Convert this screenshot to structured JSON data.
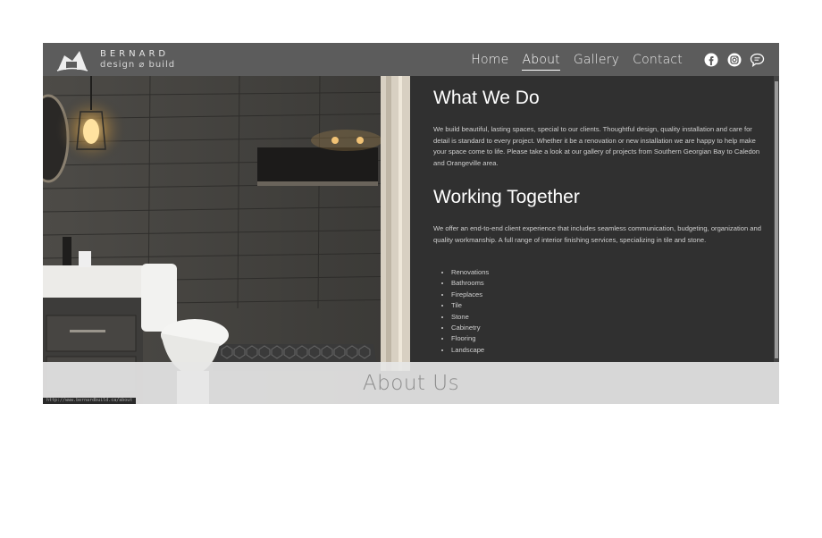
{
  "brand": {
    "name_top": "BERNARD",
    "name_bottom": "design ⌀ build"
  },
  "nav": {
    "items": [
      {
        "label": "Home"
      },
      {
        "label": "About"
      },
      {
        "label": "Gallery"
      },
      {
        "label": "Contact"
      }
    ],
    "active": "About",
    "social_icons": [
      "facebook-icon",
      "instagram-icon",
      "chat-icon"
    ]
  },
  "content": {
    "what_we_do": {
      "title": "What We Do",
      "text": "We build beautiful, lasting spaces, special to our clients. Thoughtful design, quality installation and care for detail is standard to every project. Whether it be a renovation or new installation we are happy to help make your space come to life. Please take a look at our gallery of projects from Southern Georgian Bay to Caledon and Orangeville area."
    },
    "working_together": {
      "title": "Working Together",
      "text": "We offer an end-to-end client experience that includes seamless communication, budgeting, organization and quality workmanship. A full range of interior finishing services, specializing in tile and stone.",
      "services": [
        "Renovations",
        "Bathrooms",
        "Fireplaces",
        "Tile",
        "Stone",
        "Cabinetry",
        "Flooring",
        "Landscape"
      ]
    }
  },
  "section_title": "About Us",
  "status_url": "http://www.bernardbuild.ca/about",
  "colors": {
    "nav_bg": "#5c5c5c",
    "panel_bg": "#303030",
    "band_bg": "#e6e6e6"
  }
}
